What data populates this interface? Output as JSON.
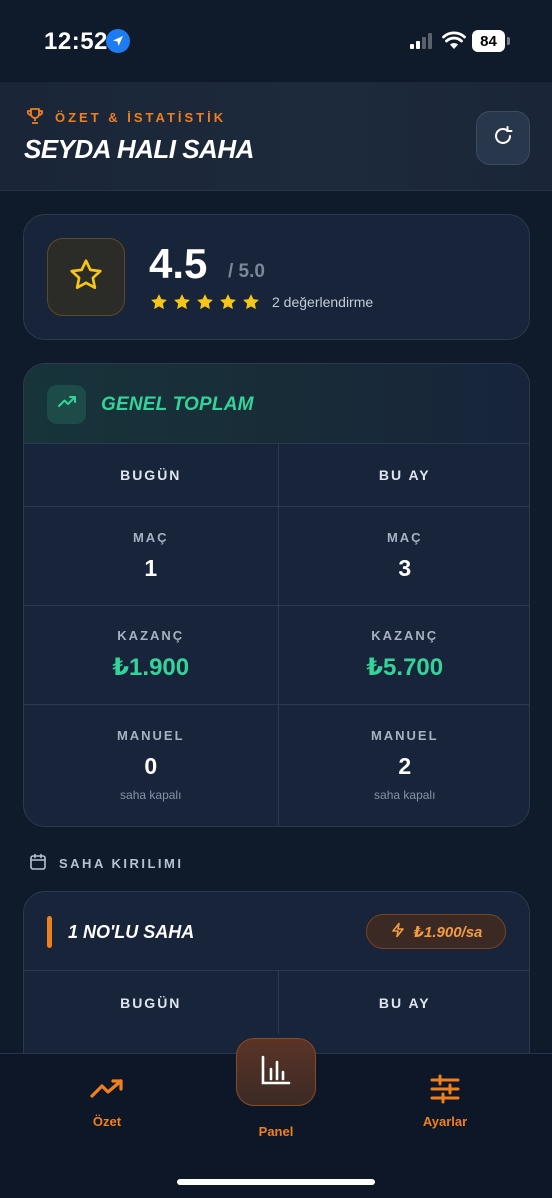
{
  "status_bar": {
    "time": "12:52",
    "battery": "84"
  },
  "header": {
    "subtitle": "ÖZET & İSTATİSTİK",
    "title": "SEYDA HALI SAHA"
  },
  "rating": {
    "value": "4.5",
    "max": "/ 5.0",
    "stars": 5,
    "count_text": "2 değerlendirme"
  },
  "total": {
    "title": "GENEL TOPLAM",
    "columns": [
      "BUGÜN",
      "BU AY"
    ],
    "rows": [
      {
        "label": "MAÇ",
        "today": "1",
        "month": "3"
      },
      {
        "label": "KAZANÇ",
        "today": "₺1.900",
        "month": "₺5.700"
      },
      {
        "label": "MANUEL",
        "today": "0",
        "month": "2",
        "note": "saha kapalı"
      }
    ]
  },
  "breakdown": {
    "label": "SAHA KIRILIMI"
  },
  "field": {
    "name": "1 NO'LU SAHA",
    "price": "₺1.900/sa",
    "columns": [
      "BUGÜN",
      "BU AY"
    ]
  },
  "tabbar": {
    "tabs": [
      "Özet",
      "Panel",
      "Ayarlar"
    ]
  },
  "colors": {
    "accent": "#f07f1e",
    "green": "#34d399",
    "star": "#f5c518",
    "background": "#0f1a2b"
  }
}
